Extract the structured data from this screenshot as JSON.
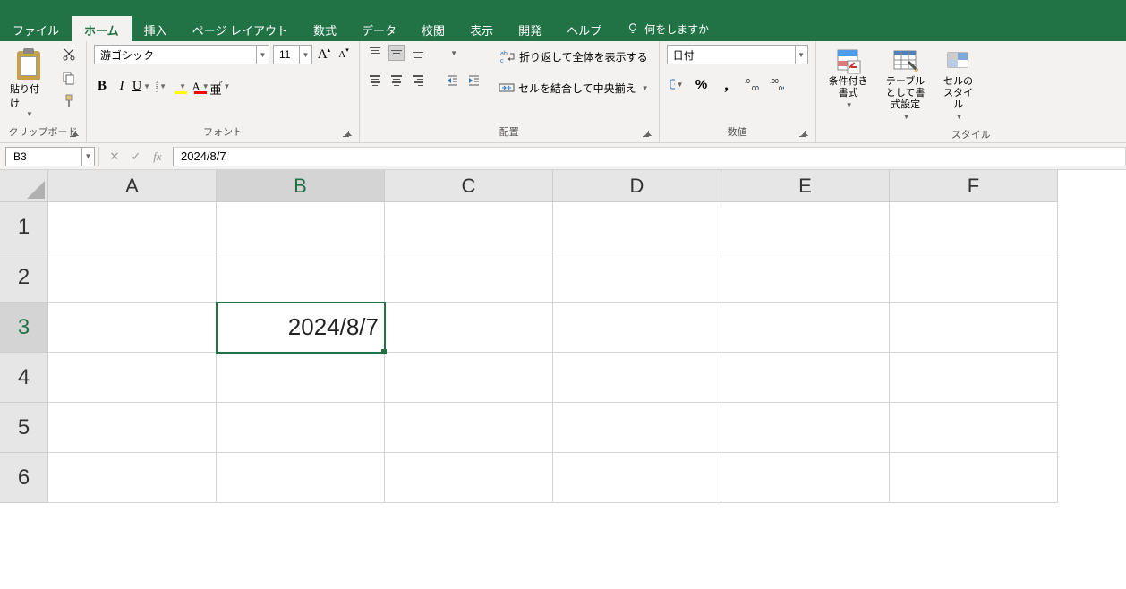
{
  "tabs": {
    "file": "ファイル",
    "home": "ホーム",
    "insert": "挿入",
    "pagelayout": "ページ レイアウト",
    "formulas": "数式",
    "data": "データ",
    "review": "校閲",
    "view": "表示",
    "developer": "開発",
    "help": "ヘルプ",
    "tellme": "何をしますか"
  },
  "ribbon": {
    "clipboard": {
      "label": "クリップボード",
      "paste": "貼り付け"
    },
    "font": {
      "label": "フォント",
      "name": "游ゴシック",
      "size": "11",
      "grow": "A",
      "grow_caret": "▴",
      "shrink": "A",
      "shrink_caret": "▾",
      "bold": "B",
      "italic": "I",
      "underline": "U",
      "fontcolor_letter": "A",
      "ruby_letter": "ア",
      "ruby_sub": "亜"
    },
    "alignment": {
      "label": "配置",
      "wrap": "折り返して全体を表示する",
      "merge": "セルを結合して中央揃え",
      "wrap_prefix": "ab",
      "wrap_arrow": "c"
    },
    "number": {
      "label": "数値",
      "format": "日付",
      "percent": "%",
      "comma": ",",
      "inc": ".0",
      "inc2": ".00",
      "dec": ".00",
      "dec2": ".0"
    },
    "styles": {
      "label": "スタイル",
      "cond": "条件付き書式",
      "table": "テーブルとして書式設定",
      "cell": "セルのスタイル"
    }
  },
  "namebox": "B3",
  "formula": "2024/8/7",
  "columns": [
    "A",
    "B",
    "C",
    "D",
    "E",
    "F"
  ],
  "rows": [
    "1",
    "2",
    "3",
    "4",
    "5",
    "6"
  ],
  "active_col": 1,
  "active_row": 2,
  "cell_value": "2024/8/7"
}
